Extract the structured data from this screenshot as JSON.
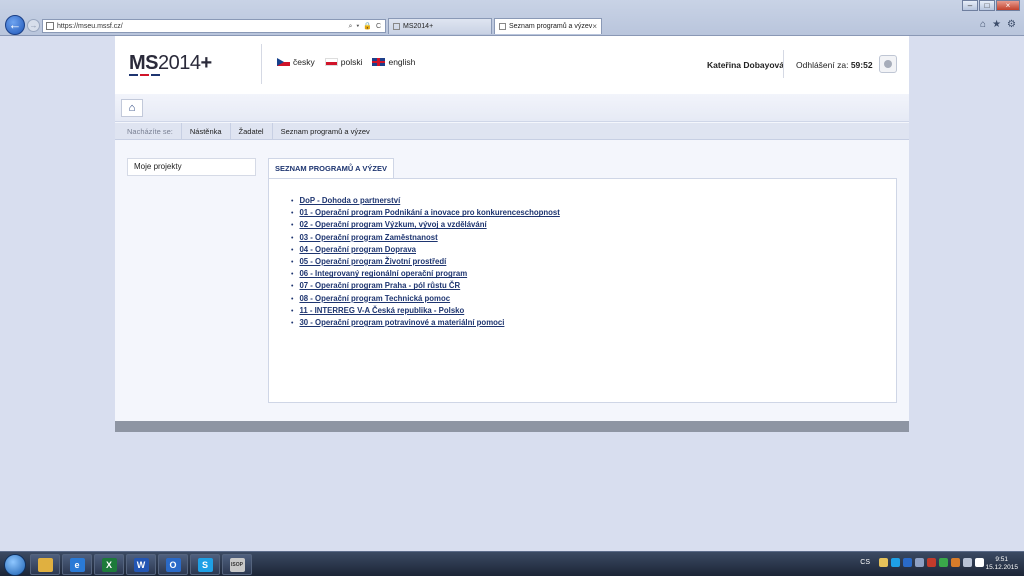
{
  "browser": {
    "url": "https://mseu.mssf.cz/",
    "address_tools": "⌕ ▾ 🔒 C",
    "tab_inactive": "MS2014+",
    "tab_active": "Seznam programů a výzev",
    "tab_close": "×",
    "window_buttons": [
      "–",
      "□",
      "×"
    ],
    "nav_back_glyph": "←",
    "nav_fwd_glyph": "→",
    "right_icons": [
      "⌂",
      "★",
      "⚙"
    ]
  },
  "header": {
    "logo_ms": "MS",
    "logo_year": "2014",
    "logo_plus": "+",
    "logo_bar_colors": [
      "#1e3570",
      "#d0142a",
      "#1e3570"
    ],
    "languages": [
      {
        "label": "česky",
        "flag": "flag-cz"
      },
      {
        "label": "polski",
        "flag": "flag-pl"
      },
      {
        "label": "english",
        "flag": "flag-en"
      }
    ],
    "user_name": "Kateřina Dobayová",
    "logout_label": "Odhlášení za:",
    "logout_timer": "59:52"
  },
  "toolbar": {
    "home_icon": "⌂"
  },
  "breadcrumb": {
    "label": "Nacházíte se:",
    "items": [
      "Nástěnka",
      "Žadatel",
      "Seznam programů a výzev"
    ]
  },
  "sidebar": {
    "my_projects": "Moje projekty"
  },
  "main": {
    "panel_title": "SEZNAM PROGRAMŮ A VÝZEV",
    "programs": [
      "DoP - Dohoda o partnerství",
      "01 - Operační program Podnikání a inovace pro konkurenceschopnost",
      "02 - Operační program Výzkum, vývoj a vzdělávání",
      "03 - Operační program Zaměstnanost",
      "04 - Operační program Doprava",
      "05 - Operační program Životní prostředí",
      "06 - Integrovaný regionální operační program",
      "07 - Operační program Praha - pól růstu ČR",
      "08 - Operační program Technická pomoc",
      "11 - INTERREG V-A Česká republika - Polsko",
      "30 - Operační program potravinové a materiální pomoci"
    ]
  },
  "colors": {
    "link": "#1e3570",
    "page_bg": "#d8deef"
  },
  "taskbar": {
    "apps": [
      {
        "name": "explorer",
        "glyph": "",
        "color": "#e0b040"
      },
      {
        "name": "internet-explorer",
        "glyph": "e",
        "color": "#2a7ad6"
      },
      {
        "name": "excel",
        "glyph": "X",
        "color": "#1d7a3a"
      },
      {
        "name": "word",
        "glyph": "W",
        "color": "#2356b4"
      },
      {
        "name": "outlook",
        "glyph": "O",
        "color": "#2a6ac8"
      },
      {
        "name": "skype",
        "glyph": "S",
        "color": "#1ea0e6"
      },
      {
        "name": "isop",
        "glyph": "ISOP",
        "color": "#c8c8c8"
      }
    ],
    "keyboard_lang": "CS",
    "time": "9:51",
    "date": "15.12.2015"
  }
}
